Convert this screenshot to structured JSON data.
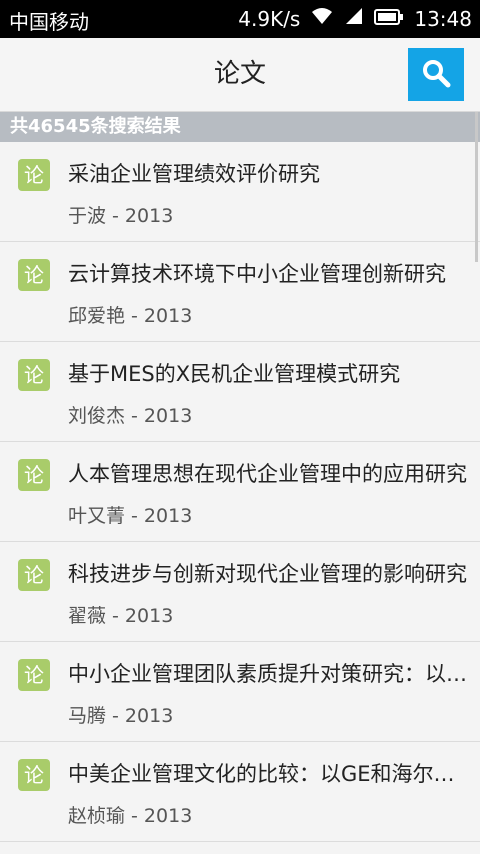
{
  "status_bar": {
    "carrier": "中国移动",
    "speed": "4.9K/s",
    "time": "13:48",
    "icons": [
      "wifi-icon",
      "signal-icon",
      "battery-icon"
    ]
  },
  "header": {
    "title": "论文",
    "search_icon": "search-icon",
    "accent_color": "#14a4e6"
  },
  "results": {
    "summary": "共46545条搜索结果"
  },
  "items": [
    {
      "icon_text": "论",
      "title": "采油企业管理绩效评价研究",
      "meta": "于波 - 2013"
    },
    {
      "icon_text": "论",
      "title": "云计算技术环境下中小企业管理创新研究",
      "meta": "邱爱艳 - 2013"
    },
    {
      "icon_text": "论",
      "title": "基于MES的X民机企业管理模式研究",
      "meta": "刘俊杰 - 2013"
    },
    {
      "icon_text": "论",
      "title": "人本管理思想在现代企业管理中的应用研究",
      "meta": "叶又菁 - 2013"
    },
    {
      "icon_text": "论",
      "title": "科技进步与创新对现代企业管理的影响研究",
      "meta": "翟薇 - 2013"
    },
    {
      "icon_text": "论",
      "title": "中小企业管理团队素质提升对策研究：以…",
      "meta": "马腾 - 2013"
    },
    {
      "icon_text": "论",
      "title": "中美企业管理文化的比较：以GE和海尔为例",
      "meta": "赵桢瑜 - 2013"
    }
  ]
}
